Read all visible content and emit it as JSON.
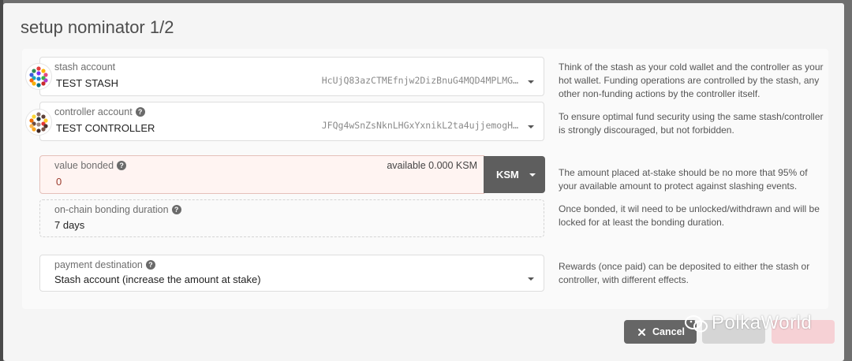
{
  "dialog": {
    "title": "setup nominator 1/2"
  },
  "stash": {
    "label": "stash account",
    "name": "TEST STASH",
    "address": "HcUjQ83azCTMEfnjw2DizBnuG4MQD4MPLMG…",
    "identicon": "stash-identicon",
    "description": "Think of the stash as your cold wallet and the controller as your hot wallet. Funding operations are controlled by the stash, any other non-funding actions by the controller itself."
  },
  "controller": {
    "label": "controller account",
    "name": "TEST CONTROLLER",
    "address": "JFQg4wSnZsNknLHGxYxnikL2ta4ujjemogH…",
    "identicon": "controller-identicon",
    "description": "To ensure optimal fund security using the same stash/controller is strongly discouraged, but not forbidden."
  },
  "bonded": {
    "label": "value bonded",
    "value": "0",
    "available_label": "available",
    "available_value": "0.000",
    "available_unit": "KSM",
    "unit_button": "KSM",
    "description": "The amount placed at-stake should be no more that 95% of your available amount to protect against slashing events."
  },
  "duration": {
    "label": "on-chain bonding duration",
    "value": "7 days",
    "description": "Once bonded, it wil need to be unlocked/withdrawn and will be locked for at least the bonding duration."
  },
  "payment": {
    "label": "payment destination",
    "value": "Stash account (increase the amount at stake)",
    "description": "Rewards (once paid) can be deposited to either the stash or controller, with different effects."
  },
  "buttons": {
    "cancel": "Cancel"
  },
  "watermark": {
    "text": "PolkaWorld"
  },
  "colors": {
    "error_bg": "#fff4f2",
    "error_border": "#e5c0b9",
    "button_dark": "#5e5e5e",
    "next_disabled": "#f6d1d5"
  }
}
